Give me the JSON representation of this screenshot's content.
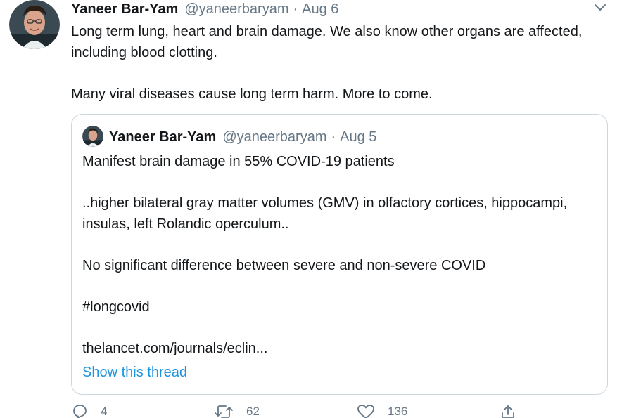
{
  "tweet": {
    "author_name": "Yaneer Bar-Yam",
    "handle": "@yaneerbaryam",
    "separator": "·",
    "date": "Aug 6",
    "body": [
      "Long term lung, heart and brain damage. We also know other organs are affected, including blood clotting.",
      "Many viral diseases cause long term harm. More to come."
    ],
    "menu_icon": "chevron-down-icon"
  },
  "quoted_tweet": {
    "author_name": "Yaneer Bar-Yam",
    "handle": "@yaneerbaryam",
    "separator": "·",
    "date": "Aug 5",
    "body": [
      "Manifest brain damage in 55% COVID-19 patients",
      "..higher bilateral gray matter volumes (GMV) in olfactory cortices, hippocampi, insulas, left Rolandic operculum..",
      "No significant difference between severe and non-severe COVID",
      "#longcovid",
      "thelancet.com/journals/eclin..."
    ],
    "thread_link": "Show this thread"
  },
  "actions": {
    "reply": {
      "icon": "reply-icon",
      "count": "4"
    },
    "retweet": {
      "icon": "retweet-icon",
      "count": "62"
    },
    "like": {
      "icon": "heart-icon",
      "count": "136"
    },
    "share": {
      "icon": "share-icon"
    }
  },
  "colors": {
    "text": "#14171a",
    "secondary": "#657786",
    "link": "#1b95e0",
    "border": "#ccd6dd"
  }
}
